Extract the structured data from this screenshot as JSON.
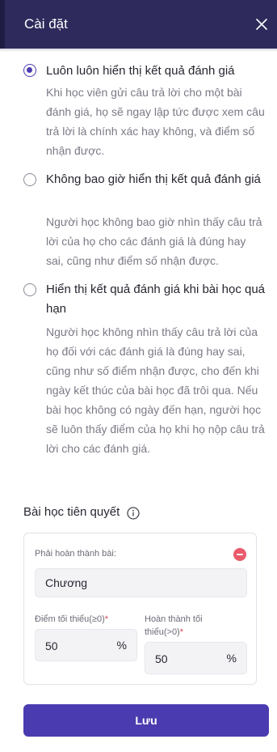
{
  "header": {
    "title": "Cài đặt",
    "close_icon": "close-icon"
  },
  "options": [
    {
      "label": "Luôn luôn hiển thị kết quả đánh giá",
      "description": "Khi học viên gửi câu trả lời cho một bài đánh giá, họ sẽ ngay lập tức được xem câu trả lời là chính xác hay không, và điểm số nhận được.",
      "selected": true
    },
    {
      "label": "Không bao giờ hiển thị kết quả đánh giá",
      "description": "Người học không bao giờ nhìn thấy câu trả lời của họ cho các đánh giá là đúng hay sai, cũng như điểm số nhận được.",
      "selected": false
    },
    {
      "label": "Hiển thị kết quả đánh giá khi bài học quá hạn",
      "description": "Người học không nhìn thấy câu trả lời của họ đối với các đánh giá là đúng hay sai, cũng như số điểm nhận được, cho đến khi ngày kết thúc của bài học đã trôi qua. Nếu bài học không có ngày đến hạn, người học sẽ luôn thấy điểm của họ khi họ nộp câu trả lời cho các đánh giá.",
      "selected": false
    }
  ],
  "prerequisite": {
    "title": "Bài học tiên quyết",
    "info_icon": "info-icon",
    "must_complete_label": "Phải hoàn thành bài:",
    "selected_lesson": "Chương",
    "min_score": {
      "label": "Điểm tối thiểu(≥0)",
      "required_mark": "*",
      "value": "50",
      "unit": "%"
    },
    "min_completion": {
      "label": "Hoàn thành tối thiểu(>0)",
      "required_mark": "*",
      "value": "50",
      "unit": "%"
    }
  },
  "save_label": "Lưu",
  "colors": {
    "header": "#2e2a5c",
    "accent": "#4b3bb0",
    "danger": "#ea5a6b"
  }
}
